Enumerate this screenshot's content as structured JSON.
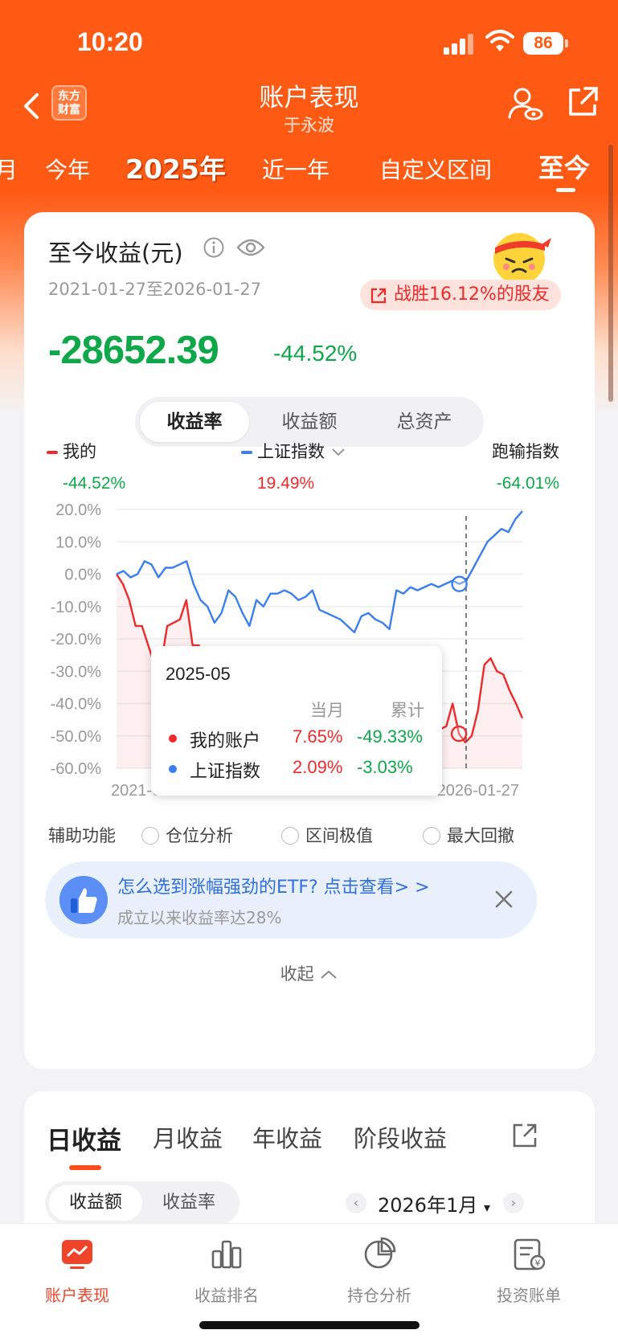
{
  "status": {
    "time": "10:20",
    "battery": "86"
  },
  "nav": {
    "title": "账户表现",
    "subtitle": "于永波",
    "logo_line1": "东方",
    "logo_line2": "财富"
  },
  "period_tabs": [
    {
      "label": "月"
    },
    {
      "label": "今年"
    },
    {
      "label": "2025年"
    },
    {
      "label": "近一年"
    },
    {
      "label": "自定义区间"
    },
    {
      "label": "至今"
    }
  ],
  "summary": {
    "title": "至今收益(元)",
    "date_range": "2021-01-27至2026-01-27",
    "beat_badge": "战胜16.12%的股友",
    "amount": "-28652.39",
    "rate": "-44.52%"
  },
  "metric_tabs": [
    "收益率",
    "收益额",
    "总资产"
  ],
  "legend": {
    "mine": {
      "label": "我的",
      "value": "-44.52%",
      "color": "#f02a2a"
    },
    "index": {
      "label": "上证指数",
      "value": "19.49%",
      "color": "#3b7ef2"
    },
    "outperform": {
      "label": "跑输指数",
      "value": "-64.01%"
    }
  },
  "chart_data": {
    "type": "line",
    "x_start": "2021-01-27",
    "x_end": "2026-01-27",
    "y_ticks": [
      "20.0%",
      "10.0%",
      "0.0%",
      "-10.0%",
      "-20.0%",
      "-30.0%",
      "-40.0%",
      "-50.0%",
      "-60.0%"
    ],
    "ylim": [
      -60,
      20
    ],
    "series": [
      {
        "name": "我的账户",
        "color": "#f02a2a",
        "values": [
          0,
          -3,
          -8,
          -16,
          -16,
          -22,
          -28,
          -28,
          -16,
          -15,
          -14,
          -8,
          -22,
          -22,
          -37,
          -37,
          -37,
          -37,
          -37,
          -37,
          -37,
          -37,
          -37,
          -37,
          -37,
          -37,
          -37,
          -37,
          -37,
          -37,
          -37,
          -37,
          -37,
          -37,
          -37,
          -37,
          -37,
          -37,
          -37,
          -37,
          -37,
          -37,
          -37,
          -37,
          -37,
          -37,
          -37,
          -32,
          -38,
          -42,
          -45,
          -48,
          -47,
          -40,
          -49.33,
          -52,
          -50,
          -42,
          -28,
          -26,
          -30,
          -31,
          -36,
          -40,
          -44.52
        ]
      },
      {
        "name": "上证指数",
        "color": "#3b7ef2",
        "values": [
          0,
          1,
          -1,
          0,
          4,
          3,
          -1,
          2,
          2,
          3,
          4,
          -3,
          -8,
          -10,
          -15,
          -12,
          -5,
          -7,
          -12,
          -16,
          -8,
          -10,
          -6,
          -6,
          -5,
          -6,
          -8,
          -7,
          -5,
          -11,
          -12,
          -13,
          -14,
          -16,
          -18,
          -13,
          -12,
          -14,
          -15,
          -17,
          -5,
          -6,
          -4,
          -5,
          -4,
          -3,
          -4,
          -3,
          -2,
          -3.03,
          -2,
          2,
          6,
          10,
          12,
          14,
          13,
          17,
          19.49
        ]
      }
    ],
    "tooltip": {
      "date": "2025-05",
      "month_header": "当月",
      "cumulative_header": "累计",
      "rows": [
        {
          "name": "我的账户",
          "month": "7.65%",
          "cumulative": "-49.33%"
        },
        {
          "name": "上证指数",
          "month": "2.09%",
          "cumulative": "-3.03%"
        }
      ]
    }
  },
  "aux": {
    "label": "辅助功能",
    "options": [
      "仓位分析",
      "区间极值",
      "最大回撤"
    ]
  },
  "promo": {
    "title": "怎么选到涨幅强劲的ETF? 点击查看> >",
    "subtitle": "成立以来收益率达28%"
  },
  "collapse_label": "收起",
  "period_profit_tabs": [
    "日收益",
    "月收益",
    "年收益",
    "阶段收益"
  ],
  "profit_toggle": [
    "收益额",
    "收益率"
  ],
  "month_selector": "2026年1月",
  "bottom_nav": [
    {
      "label": "账户表现",
      "icon": "chart-screen-icon"
    },
    {
      "label": "收益排名",
      "icon": "bar-chart-icon"
    },
    {
      "label": "持仓分析",
      "icon": "pie-chart-icon"
    },
    {
      "label": "投资账单",
      "icon": "bill-icon"
    }
  ],
  "colors": {
    "brand": "#ff5a14",
    "up": "#f02a2a",
    "down": "#0ea84a",
    "index": "#3b7ef2"
  }
}
